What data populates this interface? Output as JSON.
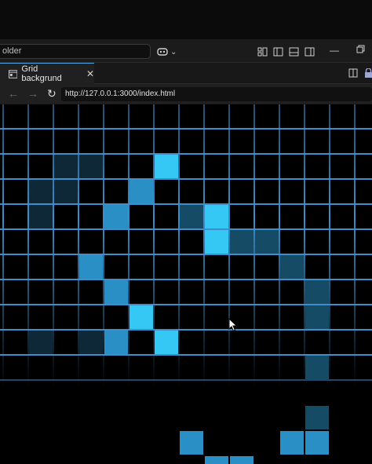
{
  "window": {
    "search_text": "older",
    "copilot_chevron": "⌄",
    "layout_icons": [
      "customize-layout-icon",
      "toggle-sidebar-left-icon",
      "toggle-panel-icon",
      "toggle-sidebar-right-icon"
    ],
    "window_controls": [
      "minimize-icon",
      "restore-icon"
    ]
  },
  "tab": {
    "title": "Grid backgrund",
    "close": "✕"
  },
  "address": {
    "url": "http://127.0.0.1:3000/index.html"
  },
  "colors": {
    "grid_line": "#3d8fcc",
    "bright": "#35c8f5",
    "mid": "#2a8fc4",
    "dim": "#164b66",
    "faint": "#0f2838",
    "background": "#000000"
  },
  "grid": {
    "cells": [
      {
        "col": 2,
        "row": 2,
        "level": "faint"
      },
      {
        "col": 3,
        "row": 2,
        "level": "faint"
      },
      {
        "col": 6,
        "row": 2,
        "level": "bright"
      },
      {
        "col": 1,
        "row": 3,
        "level": "faint"
      },
      {
        "col": 2,
        "row": 3,
        "level": "faint"
      },
      {
        "col": 5,
        "row": 3,
        "level": "mid"
      },
      {
        "col": 1,
        "row": 4,
        "level": "faint"
      },
      {
        "col": 4,
        "row": 4,
        "level": "mid"
      },
      {
        "col": 7,
        "row": 4,
        "level": "dim"
      },
      {
        "col": 8,
        "row": 4,
        "level": "bright"
      },
      {
        "col": 8,
        "row": 5,
        "level": "bright"
      },
      {
        "col": 9,
        "row": 5,
        "level": "dim"
      },
      {
        "col": 10,
        "row": 5,
        "level": "dim"
      },
      {
        "col": 3,
        "row": 6,
        "level": "mid"
      },
      {
        "col": 11,
        "row": 6,
        "level": "dim"
      },
      {
        "col": 4,
        "row": 7,
        "level": "mid"
      },
      {
        "col": 12,
        "row": 7,
        "level": "dim"
      },
      {
        "col": 5,
        "row": 8,
        "level": "bright"
      },
      {
        "col": 12,
        "row": 8,
        "level": "dim"
      },
      {
        "col": 1,
        "row": 9,
        "level": "faint"
      },
      {
        "col": 3,
        "row": 9,
        "level": "faint"
      },
      {
        "col": 4,
        "row": 9,
        "level": "mid"
      },
      {
        "col": 6,
        "row": 9,
        "level": "bright"
      },
      {
        "col": 12,
        "row": 10,
        "level": "dim"
      },
      {
        "col": 12,
        "row": 12,
        "level": "dim"
      },
      {
        "col": 7,
        "row": 13,
        "level": "mid"
      },
      {
        "col": 11,
        "row": 13,
        "level": "mid"
      },
      {
        "col": 12,
        "row": 13,
        "level": "mid"
      },
      {
        "col": 8,
        "row": 14,
        "level": "mid"
      },
      {
        "col": 9,
        "row": 14,
        "level": "mid"
      }
    ]
  }
}
